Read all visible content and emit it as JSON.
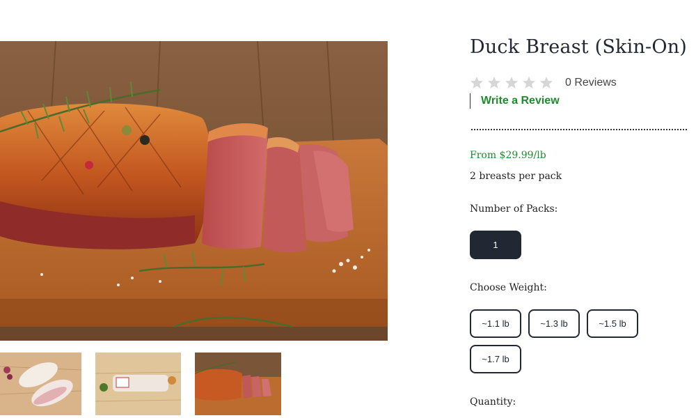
{
  "product": {
    "title": "Duck Breast (Skin-On)",
    "rating": {
      "stars_filled": 0,
      "stars_total": 5,
      "reviews_label": "0 Reviews"
    },
    "write_review_label": "Write a Review",
    "price": "From $29.99/lb",
    "pack_note": "2 breasts per pack"
  },
  "packs": {
    "label": "Number of Packs:",
    "options": [
      "1"
    ],
    "selected": "1"
  },
  "weight": {
    "label": "Choose Weight:",
    "options": [
      "~1.1 lb",
      "~1.3 lb",
      "~1.5 lb",
      "~1.7 lb"
    ]
  },
  "quantity": {
    "label": "Quantity:"
  },
  "colors": {
    "accent_green": "#1f8a2e",
    "dark_navy": "#222833",
    "star_empty": "#d6d6d6"
  }
}
